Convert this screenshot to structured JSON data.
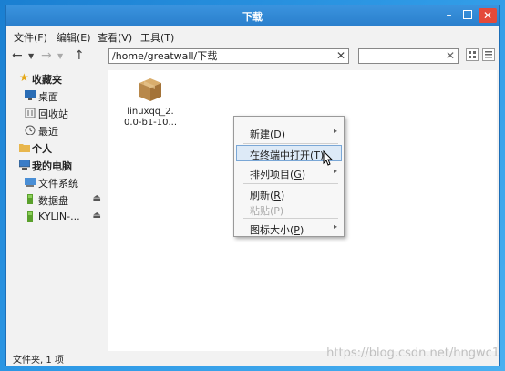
{
  "window": {
    "title": "下载"
  },
  "menubar": {
    "items": [
      "文件(F)",
      "编辑(E)",
      "查看(V)",
      "工具(T)"
    ]
  },
  "toolbar": {
    "path": "/home/greatwall/下载"
  },
  "sidebar": {
    "favorites": {
      "label": "收藏夹",
      "items": [
        "桌面",
        "回收站",
        "最近"
      ]
    },
    "personal": {
      "label": "个人"
    },
    "computer": {
      "label": "我的电脑",
      "items": [
        "文件系统",
        "数据盘",
        "KYLIN-..."
      ]
    }
  },
  "files": [
    {
      "name_line1": "linuxqq_2.",
      "name_line2": "0.0-b1-10...",
      "icon": "package-icon"
    }
  ],
  "context_menu": {
    "items": [
      {
        "label": "新建(",
        "key": "D",
        "end": ")",
        "submenu": true
      },
      {
        "label": "在终端中打开(",
        "key": "T",
        "end": ")",
        "highlighted": true
      },
      {
        "label": "排列项目(",
        "key": "G",
        "end": ")",
        "submenu": true
      },
      {
        "label": "刷新(",
        "key": "R",
        "end": ")"
      },
      {
        "label": "粘贴(P)",
        "disabled": true
      },
      {
        "label": "图标大小(",
        "key": "P",
        "end": ")",
        "submenu": true
      }
    ]
  },
  "statusbar": {
    "text": "文件夹, 1 项"
  },
  "watermark": "https://blog.csdn.net/hngwc1",
  "colors": {
    "titlebar": "#2a7fcc",
    "close": "#e44a3a",
    "highlight": "#ddeaf7"
  }
}
